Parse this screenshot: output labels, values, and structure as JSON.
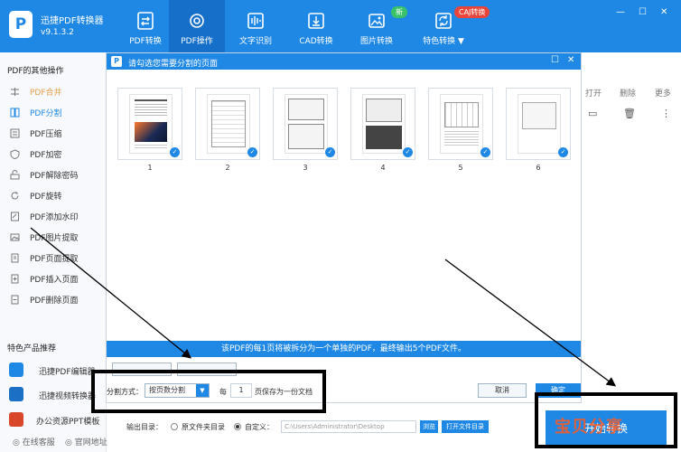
{
  "app": {
    "title": "迅捷PDF转换器",
    "version": "v9.1.3.2",
    "logo_glyph": "P"
  },
  "nav": [
    {
      "label": "PDF转换",
      "icon": "convert-icon",
      "active": false
    },
    {
      "label": "PDF操作",
      "icon": "gear-icon",
      "active": true
    },
    {
      "label": "文字识别",
      "icon": "ocr-icon",
      "active": false
    },
    {
      "label": "CAD转换",
      "icon": "cad-icon",
      "active": false
    },
    {
      "label": "图片转换",
      "icon": "image-icon",
      "active": false
    },
    {
      "label": "特色转换 ▼",
      "icon": "special-icon",
      "active": false
    }
  ],
  "badges": {
    "new": "新",
    "caj": "CAJ转换"
  },
  "window_controls": {
    "minimize": "—",
    "maximize": "☐",
    "close": "✕"
  },
  "sidebar": {
    "heading": "PDF的其他操作",
    "items": [
      {
        "label": "PDF合并",
        "icon": "merge-icon",
        "state": "dim"
      },
      {
        "label": "PDF分割",
        "icon": "split-icon",
        "state": "active"
      },
      {
        "label": "PDF压缩",
        "icon": "compress-icon",
        "state": ""
      },
      {
        "label": "PDF加密",
        "icon": "lock-icon",
        "state": ""
      },
      {
        "label": "PDF解除密码",
        "icon": "unlock-icon",
        "state": ""
      },
      {
        "label": "PDF旋转",
        "icon": "rotate-icon",
        "state": ""
      },
      {
        "label": "PDF添加水印",
        "icon": "watermark-icon",
        "state": ""
      },
      {
        "label": "PDF图片提取",
        "icon": "image-extract-icon",
        "state": ""
      },
      {
        "label": "PDF页面提取",
        "icon": "page-extract-icon",
        "state": ""
      },
      {
        "label": "PDF插入页面",
        "icon": "insert-page-icon",
        "state": ""
      },
      {
        "label": "PDF删除页面",
        "icon": "delete-page-icon",
        "state": ""
      }
    ],
    "featured_heading": "特色产品推荐",
    "featured": [
      {
        "label": "迅捷PDF编辑器",
        "color": "#1f88e5"
      },
      {
        "label": "迅捷视频转换器",
        "color": "#1b6fc4"
      },
      {
        "label": "办公资源PPT模板",
        "color": "#d9472b"
      }
    ],
    "footer": {
      "service": "在线客服",
      "website": "官网地址"
    }
  },
  "background_actions": {
    "open": "打开",
    "delete": "删除",
    "more": "更多"
  },
  "dialog": {
    "title": "请勾选您需要分割的页面",
    "pages": [
      "1",
      "2",
      "3",
      "4",
      "5",
      "6"
    ],
    "info": "该PDF的每1页将被拆分为一个单独的PDF，最终输出5个PDF文件。",
    "split_label": "分割方式：",
    "split_mode": "按页数分割",
    "every_label": "每",
    "every_value": "1",
    "every_suffix": "页保存为一份文档",
    "cancel": "取消",
    "ok": "确定"
  },
  "output": {
    "label": "输出目录：",
    "option_original": "原文件夹目录",
    "option_custom": "自定义：",
    "path": "C:\\Users\\Administrator\\Desktop",
    "browse": "浏览",
    "open_folder": "打开文件目录"
  },
  "start_button": "开始转换",
  "watermark": "宝贝分享"
}
